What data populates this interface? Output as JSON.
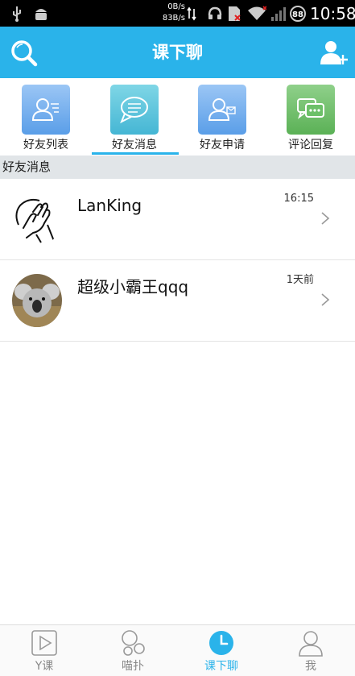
{
  "status_bar": {
    "net_speed_up": "0B/s",
    "net_speed_down": "83B/s",
    "battery": "88",
    "time": "10:58"
  },
  "header": {
    "title": "课下聊"
  },
  "tabs": [
    {
      "label": "好友列表"
    },
    {
      "label": "好友消息"
    },
    {
      "label": "好友申请"
    },
    {
      "label": "评论回复"
    }
  ],
  "section": {
    "title": "好友消息"
  },
  "messages": [
    {
      "name": "LanKing",
      "time": "16:15"
    },
    {
      "name": "超级小霸王qqq",
      "time": "1天前"
    }
  ],
  "bottom_nav": [
    {
      "label": "Y课"
    },
    {
      "label": "喵扑"
    },
    {
      "label": "课下聊"
    },
    {
      "label": "我"
    }
  ],
  "colors": {
    "accent": "#2ab3ea",
    "status_bar": "#000000",
    "section_header_bg": "#e1e5e8"
  }
}
